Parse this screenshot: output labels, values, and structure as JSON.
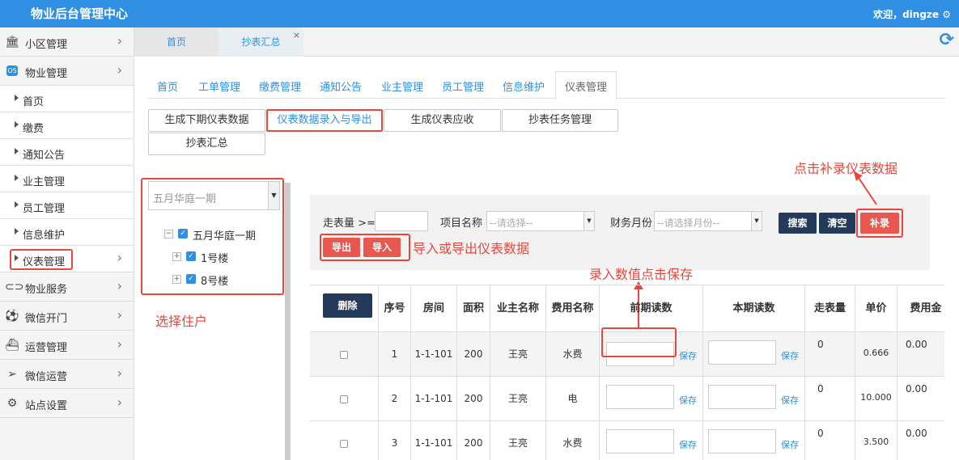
{
  "header": {
    "title": "物业后台管理中心",
    "user": "欢迎，dingze ⚙"
  },
  "sidebar": {
    "top_items": [
      {
        "label": "小区管理",
        "icon": "bank-icon"
      },
      {
        "label": "物业管理",
        "icon": "os-icon"
      }
    ],
    "sub_items": [
      {
        "label": "首页"
      },
      {
        "label": "缴费"
      },
      {
        "label": "通知公告"
      },
      {
        "label": "业主管理"
      },
      {
        "label": "员工管理"
      },
      {
        "label": "信息维护"
      },
      {
        "label": "仪表管理"
      }
    ],
    "bottom_items": [
      {
        "label": "物业服务",
        "icon": "toggle-icon"
      },
      {
        "label": "微信开门",
        "icon": "ball-icon"
      },
      {
        "label": "运营管理",
        "icon": "ship-icon"
      },
      {
        "label": "微信运营",
        "icon": "send-icon"
      },
      {
        "label": "站点设置",
        "icon": "gears-icon"
      }
    ]
  },
  "tabs": [
    {
      "label": "首页"
    },
    {
      "label": "抄表汇总",
      "close": "×"
    }
  ],
  "nav": [
    "首页",
    "工单管理",
    "缴费管理",
    "通知公告",
    "业主管理",
    "员工管理",
    "信息维护",
    "仪表管理"
  ],
  "subnav": [
    "生成下期仪表数据",
    "仪表数据录入与导出",
    "生成仪表应收",
    "抄表任务管理",
    "抄表汇总"
  ],
  "tree": {
    "select_value": "五月华庭一期",
    "root": "五月华庭一期",
    "children": [
      "1号楼",
      "8号楼"
    ],
    "expand_root": "−",
    "expand_child": "+"
  },
  "annotations": {
    "select_households": "选择住户",
    "import_export": "导入或导出仪表数据",
    "supplement": "点击补录仪表数据",
    "enter_save": "录入数值点击保存"
  },
  "filter": {
    "meter_label": "走表量 >=",
    "project_label": "项目名称",
    "project_placeholder": "--请选择--",
    "month_label": "财务月份",
    "month_placeholder": "--请选择月份--",
    "search": "搜索",
    "clear": "清空",
    "supplement": "补录",
    "export": "导出",
    "import": "导入"
  },
  "table": {
    "delete": "删除",
    "headers": [
      "序号",
      "房间",
      "面积",
      "业主名称",
      "费用名称",
      "前期读数",
      "本期读数",
      "走表量",
      "单价",
      "费用金"
    ],
    "save_label": "保存",
    "rows": [
      {
        "no": "1",
        "room": "1-1-101",
        "area": "200",
        "owner": "王亮",
        "fee": "水费",
        "meter": "0",
        "price": "0.666",
        "amount": "0.00"
      },
      {
        "no": "2",
        "room": "1-1-101",
        "area": "200",
        "owner": "王亮",
        "fee": "电",
        "meter": "0",
        "price": "10.000",
        "amount": "0.00"
      },
      {
        "no": "3",
        "room": "1-1-101",
        "area": "200",
        "owner": "王亮",
        "fee": "水费",
        "meter": "0",
        "price": "3.500",
        "amount": "0.00"
      }
    ]
  },
  "colors": {
    "brand": "#2f8fe3",
    "highlight": "#e8463c",
    "dark_button": "#243a5a"
  }
}
